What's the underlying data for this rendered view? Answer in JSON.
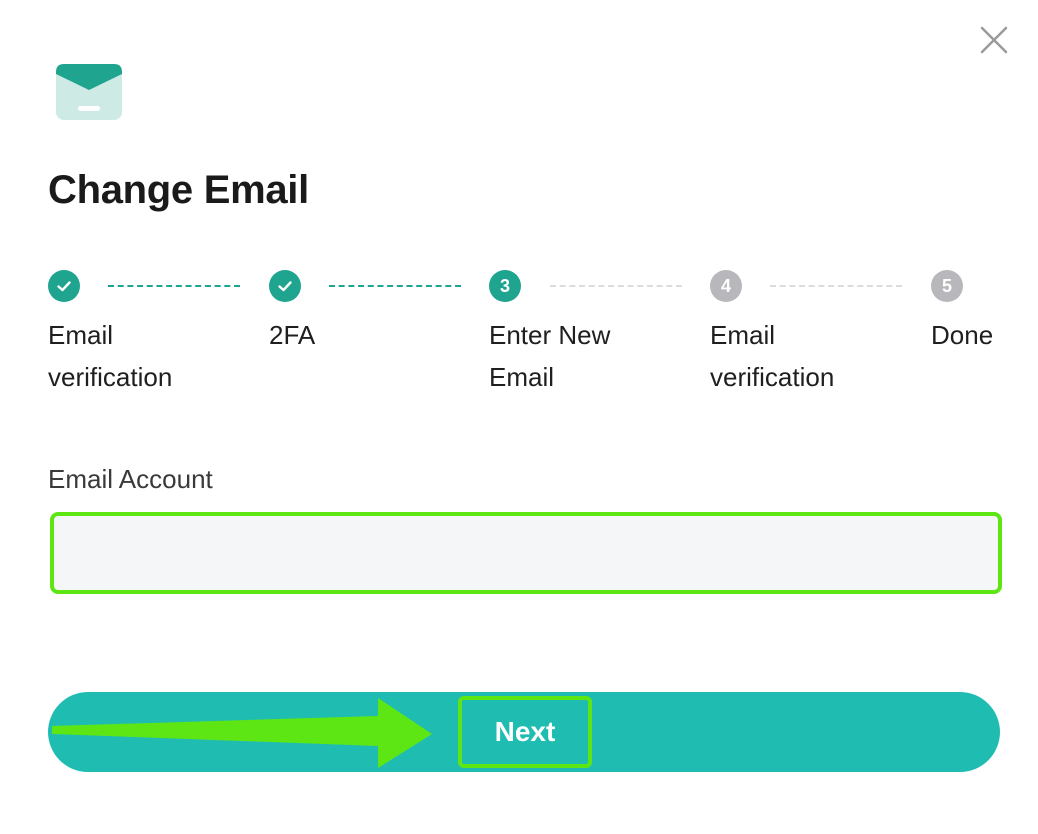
{
  "dialog": {
    "title": "Change Email",
    "close_icon": "close-icon",
    "logo_icon": "envelope-icon"
  },
  "stepper": {
    "steps": [
      {
        "number": "1",
        "label": "Email verification",
        "status": "done"
      },
      {
        "number": "2",
        "label": "2FA",
        "status": "done"
      },
      {
        "number": "3",
        "label": "Enter New Email",
        "status": "active"
      },
      {
        "number": "4",
        "label": "Email verification",
        "status": "pending"
      },
      {
        "number": "5",
        "label": "Done",
        "status": "pending"
      }
    ]
  },
  "form": {
    "email_label": "Email Account",
    "email_value": "",
    "email_placeholder": ""
  },
  "actions": {
    "next_label": "Next"
  },
  "colors": {
    "accent": "#1fa48f",
    "button": "#1fbdb1",
    "pending": "#b8b8bc",
    "highlight": "#5ee614"
  }
}
